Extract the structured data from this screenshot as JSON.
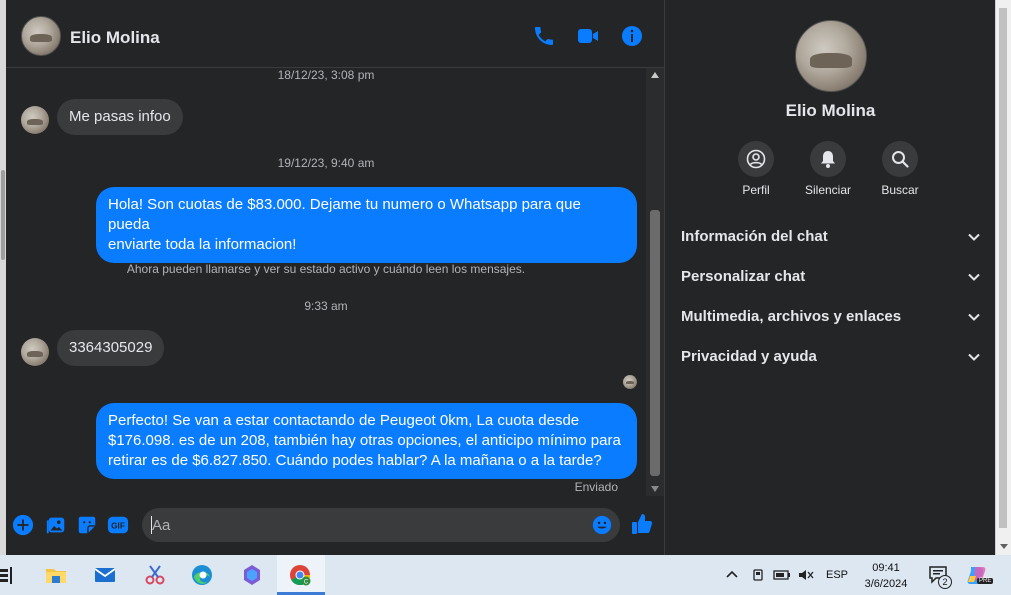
{
  "chat": {
    "contact_name": "Elio Molina",
    "messages": [
      {
        "type": "timestamp",
        "text": "18/12/23, 3:08 pm"
      },
      {
        "type": "incoming",
        "text": "Me pasas infoo"
      },
      {
        "type": "timestamp",
        "text": "19/12/23, 9:40 am"
      },
      {
        "type": "outgoing",
        "lines": [
          "Hola! Son cuotas de $83.000. Dejame tu numero o Whatsapp para que pueda",
          "enviarte toda la informacion!"
        ]
      },
      {
        "type": "system",
        "text": "Ahora pueden llamarse y ver su estado activo y cuándo leen los mensajes."
      },
      {
        "type": "timestamp",
        "text": "9:33 am"
      },
      {
        "type": "incoming",
        "text": "3364305029"
      },
      {
        "type": "outgoing",
        "lines": [
          "Perfecto!  Se van a estar contactando de Peugeot 0km, La cuota desde",
          "$176.098. es de un 208, también hay otras opciones, el anticipo mínimo para",
          "retirar es de $6.827.850. Cuándo podes hablar? A la mañana o a la tarde?"
        ]
      },
      {
        "type": "status",
        "text": "Enviado"
      }
    ],
    "composer_placeholder": "Aa"
  },
  "info_panel": {
    "name": "Elio Molina",
    "actions": [
      "Perfil",
      "Silenciar",
      "Buscar"
    ],
    "sections": [
      "Información del chat",
      "Personalizar chat",
      "Multimedia, archivos y enlaces",
      "Privacidad y ayuda"
    ]
  },
  "taskbar": {
    "language": "ESP",
    "time": "09:41",
    "date": "3/6/2024",
    "notification_count": "2",
    "copilot_badge": "PRE"
  },
  "colors": {
    "background": "#242526",
    "bubble_incoming": "#3a3b3c",
    "bubble_outgoing": "#0a7cff",
    "accent": "#0a7cff"
  }
}
